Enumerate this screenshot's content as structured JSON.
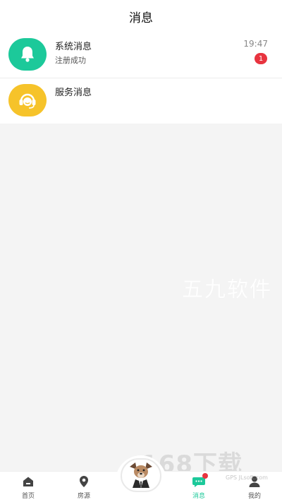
{
  "header": {
    "title": "消息"
  },
  "messages": [
    {
      "title": "系统消息",
      "subtitle": "注册成功",
      "time": "19:47",
      "badge": "1",
      "icon": "bell-icon",
      "color": "#1cc99a"
    },
    {
      "title": "服务消息",
      "subtitle": "",
      "time": "",
      "badge": "",
      "icon": "customer-service-icon",
      "color": "#f6c32a"
    }
  ],
  "watermark": {
    "text": "五九软件",
    "logo": "168下载",
    "logo_sub": "GPS JLsoft.com"
  },
  "tabbar": {
    "tabs": [
      {
        "label": "首页",
        "icon": "home-icon"
      },
      {
        "label": "房源",
        "icon": "location-pin-icon"
      },
      {
        "label": "消息",
        "icon": "chat-bubble-icon",
        "active": true
      },
      {
        "label": "我的",
        "icon": "user-icon"
      }
    ],
    "center_icon": "dog-mascot-icon",
    "active_color": "#1cc99a"
  }
}
